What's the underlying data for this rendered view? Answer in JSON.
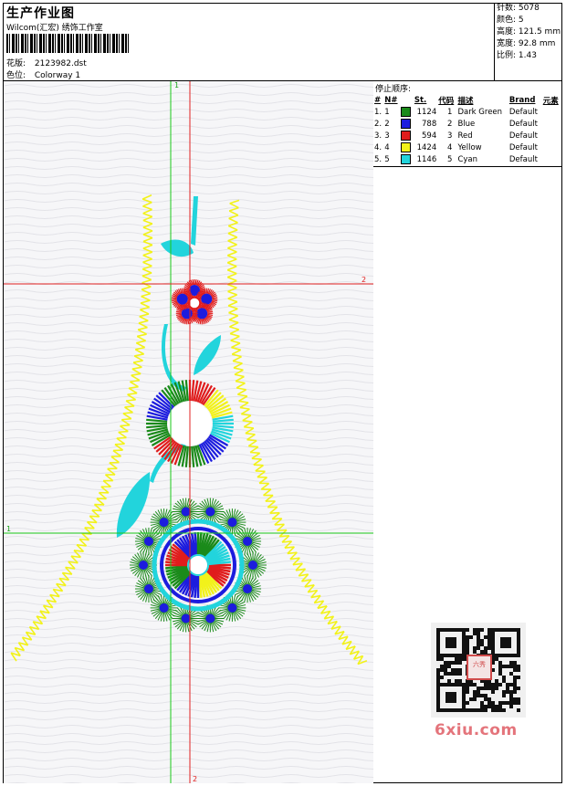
{
  "header": {
    "title": "生产作业图",
    "company": "Wilcom(汇宏) 绣饰工作室",
    "design_label": "花版:",
    "design_file": "2123982.dst",
    "colorway_label": "色位:",
    "colorway": "Colorway 1"
  },
  "stats": {
    "stitches_label": "针数:",
    "stitches": "5078",
    "colors_label": "颜色:",
    "colors": "5",
    "height_label": "高度:",
    "height": "121.5 mm",
    "width_label": "宽度:",
    "width": "92.8 mm",
    "scale_label": "比例:",
    "scale": "1.43"
  },
  "stop_sequence": {
    "title": "停止顺序:",
    "headers": {
      "hash": "#",
      "no": "N#",
      "st": "St.",
      "code": "代码",
      "desc": "描述",
      "brand": "Brand",
      "elem": "元素"
    },
    "rows": [
      {
        "idx": "1.",
        "n": "1",
        "color": "#1a8a1a",
        "st": "1124",
        "code": "1",
        "desc": "Dark Green",
        "brand": "Default"
      },
      {
        "idx": "2.",
        "n": "2",
        "color": "#1c1cde",
        "st": "788",
        "code": "2",
        "desc": "Blue",
        "brand": "Default"
      },
      {
        "idx": "3.",
        "n": "3",
        "color": "#e01c1c",
        "st": "594",
        "code": "3",
        "desc": "Red",
        "brand": "Default"
      },
      {
        "idx": "4.",
        "n": "4",
        "color": "#f2f21a",
        "st": "1424",
        "code": "4",
        "desc": "Yellow",
        "brand": "Default"
      },
      {
        "idx": "5.",
        "n": "5",
        "color": "#22d4dc",
        "st": "1146",
        "code": "5",
        "desc": "Cyan",
        "brand": "Default"
      }
    ]
  },
  "guides": {
    "top_label": "1",
    "right_label": "2",
    "left_label": "1",
    "bottom_label": "2"
  },
  "watermark": {
    "site": "6xiu.com",
    "seal": "六秀"
  }
}
